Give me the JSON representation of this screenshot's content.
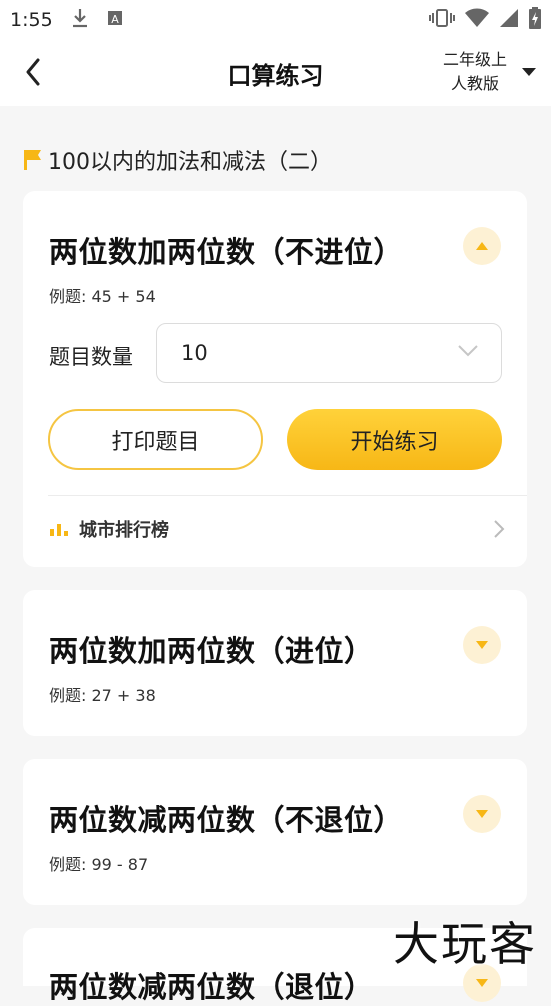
{
  "status_bar": {
    "time": "1:55",
    "icons_left": [
      "download-icon",
      "a-square-icon"
    ],
    "icons_right": [
      "vibrate-icon",
      "wifi-icon",
      "signal-icon",
      "battery-icon"
    ]
  },
  "app_bar": {
    "title": "口算练习",
    "grade_line1": "二年级上",
    "grade_line2": "人教版"
  },
  "section": {
    "title": "100以内的加法和减法（二）"
  },
  "cards": [
    {
      "title": "两位数加两位数（不进位）",
      "example": "例题: 45 + 54",
      "expanded": true,
      "count_label": "题目数量",
      "count_value": "10",
      "print_label": "打印题目",
      "start_label": "开始练习",
      "rank_label": "城市排行榜"
    },
    {
      "title": "两位数加两位数（进位）",
      "example": "例题: 27 + 38",
      "expanded": false
    },
    {
      "title": "两位数减两位数（不退位）",
      "example": "例题: 99 - 87",
      "expanded": false
    },
    {
      "title": "两位数减两位数（退位）",
      "example": "",
      "expanded": false
    }
  ],
  "watermark": "大玩客",
  "colors": {
    "accent": "#f7b716",
    "accent_light": "#fdf1d4",
    "background": "#f6f6f6"
  }
}
